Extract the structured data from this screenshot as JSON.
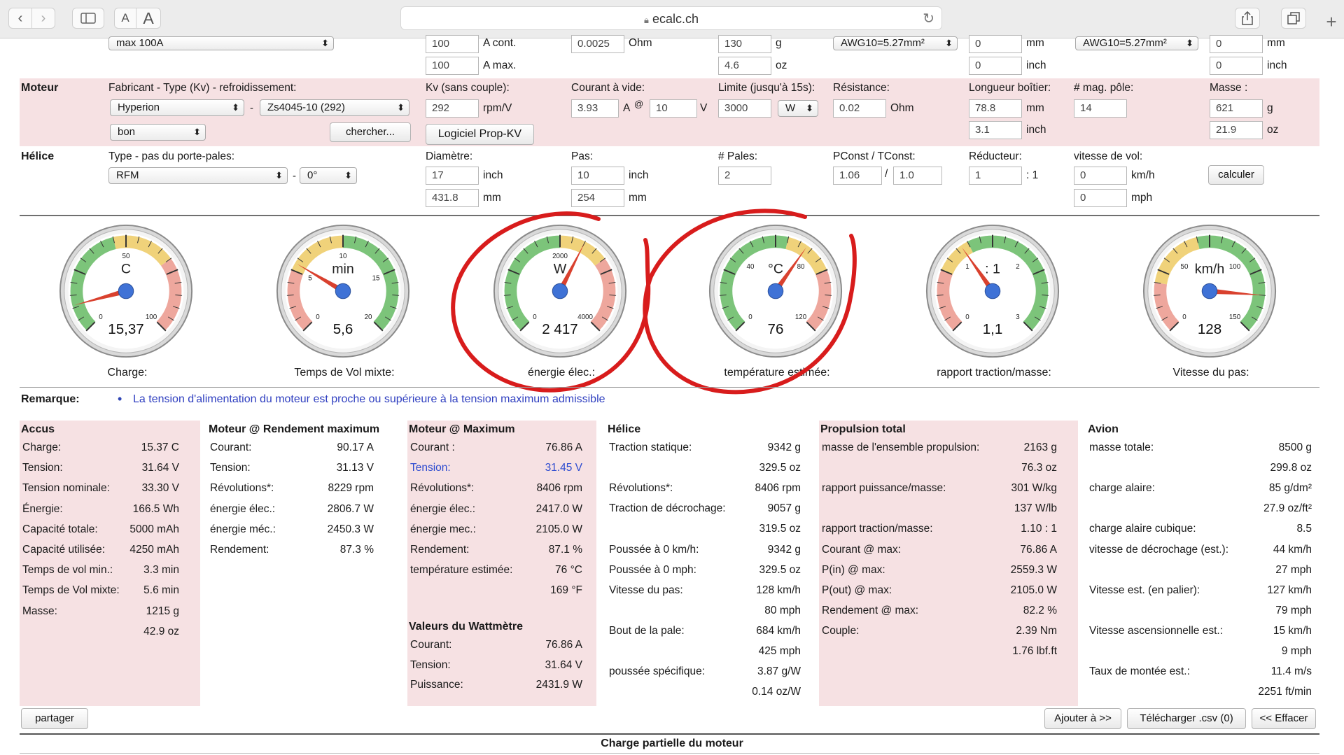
{
  "browser": {
    "url": "ecalc.ch",
    "font_small": "A",
    "font_large": "A"
  },
  "esc_row": {
    "select_value": "max 100A",
    "cont_current": "100",
    "cont_unit": "A cont.",
    "max_current": "100",
    "max_unit": "A max.",
    "resistance": "0.0025",
    "resistance_unit": "Ohm",
    "weight_g": "130",
    "weight_g_unit": "g",
    "weight_oz": "4.6",
    "weight_oz_unit": "oz",
    "wire1": "AWG10=5.27mm²",
    "wire1_mm": "0",
    "wire1_mm_unit": "mm",
    "wire1_inch": "0",
    "wire1_inch_unit": "inch",
    "wire2": "AWG10=5.27mm²",
    "wire2_mm": "0",
    "wire2_mm_unit": "mm",
    "wire2_inch": "0",
    "wire2_inch_unit": "inch"
  },
  "moteur": {
    "title": "Moteur",
    "maker_label": "Fabricant - Type (Kv) - refroidissement:",
    "maker": "Hyperion",
    "dash": "-",
    "type": "Zs4045-10 (292)",
    "cooling": "bon",
    "search_button": "chercher...",
    "kv_label": "Kv (sans couple):",
    "kv": "292",
    "kv_unit": "rpm/V",
    "propkv_button": "Logiciel Prop-KV",
    "idle_label": "Courant à vide:",
    "idle_current": "3.93",
    "idle_unit": "A",
    "at": "@",
    "idle_voltage": "10",
    "idle_v_unit": "V",
    "limit_label": "Limite (jusqu'à 15s):",
    "limit": "3000",
    "limit_unit": "W",
    "res_label": "Résistance:",
    "res": "0.02",
    "res_unit": "Ohm",
    "len_label": "Longueur boîtier:",
    "len_mm": "78.8",
    "len_mm_unit": "mm",
    "len_inch": "3.1",
    "len_inch_unit": "inch",
    "poles_label": "# mag. pôle:",
    "poles": "14",
    "mass_label": "Masse :",
    "mass_g": "621",
    "mass_g_unit": "g",
    "mass_oz": "21.9",
    "mass_oz_unit": "oz"
  },
  "helice": {
    "title": "Hélice",
    "type_label": "Type - pas du porte-pales:",
    "type": "RFM",
    "dash": "-",
    "pitch_angle": "0°",
    "diam_label": "Diamètre:",
    "diam_inch": "17",
    "diam_inch_unit": "inch",
    "diam_mm": "431.8",
    "diam_mm_unit": "mm",
    "pitch_label": "Pas:",
    "pitch_inch": "10",
    "pitch_inch_unit": "inch",
    "pitch_mm": "254",
    "pitch_mm_unit": "mm",
    "blades_label": "# Pales:",
    "blades": "2",
    "pconst_label": "PConst / TConst:",
    "pconst": "1.06",
    "slash": "/",
    "tconst": "1.0",
    "gear_label": "Réducteur:",
    "gear": "1",
    "gear_unit": ": 1",
    "speed_label": "vitesse de vol:",
    "speed_kmh": "0",
    "speed_kmh_unit": "km/h",
    "speed_mph": "0",
    "speed_mph_unit": "mph",
    "calc_button": "calculer"
  },
  "gauges": [
    {
      "unit": "C",
      "ticks": [
        "0",
        "50",
        "100"
      ],
      "value": "15,37",
      "caption": "Charge:",
      "needle_fraction": 0.11
    },
    {
      "unit": "min",
      "ticks": [
        "0",
        "5",
        "10",
        "15",
        "20"
      ],
      "value": "5,6",
      "caption": "Temps de Vol mixte:",
      "needle_fraction": 0.28
    },
    {
      "unit": "W",
      "ticks": [
        "0",
        "2000",
        "4000"
      ],
      "value": "2 417",
      "caption": "énergie élec.:",
      "needle_fraction": 0.6
    },
    {
      "unit": "°C",
      "ticks": [
        "0",
        "40",
        "80",
        "120"
      ],
      "value": "76",
      "caption": "température estimée:",
      "needle_fraction": 0.63
    },
    {
      "unit": ": 1",
      "ticks": [
        "0",
        "1",
        "2",
        "3"
      ],
      "value": "1,1",
      "caption": "rapport traction/masse:",
      "needle_fraction": 0.37
    },
    {
      "unit": "km/h",
      "ticks": [
        "0",
        "50",
        "100",
        "150"
      ],
      "value": "128",
      "caption": "Vitesse du pas:",
      "needle_fraction": 0.85
    }
  ],
  "gauge_colors": {
    "green": "#7cc47a",
    "yellow": "#f0d27a",
    "red": "#eea79d",
    "needle": "#d9412e",
    "hub": "#3f72d6",
    "annotation": "#d81c1c"
  },
  "remark": {
    "label": "Remarque:",
    "bullet": "•",
    "text": "La tension d'alimentation du moteur est proche ou supérieure à la tension maximum admissible"
  },
  "accus": {
    "title": "Accus",
    "rows": [
      {
        "label": "Charge:",
        "value": "15.37 C"
      },
      {
        "label": "Tension:",
        "value": "31.64 V"
      },
      {
        "label": "Tension nominale:",
        "value": "33.30 V"
      },
      {
        "label": "Énergie:",
        "value": "166.5 Wh"
      },
      {
        "label": "Capacité totale:",
        "value": "5000 mAh"
      },
      {
        "label": "Capacité utilisée:",
        "value": "4250 mAh"
      },
      {
        "label": "Temps de vol min.:",
        "value": "3.3 min"
      },
      {
        "label": "Temps de Vol mixte:",
        "value": "5.6 min"
      },
      {
        "label": "Masse:",
        "value": "1215 g"
      },
      {
        "label": "",
        "value": "42.9 oz"
      }
    ]
  },
  "moteur_eff": {
    "title": "Moteur @ Rendement maximum",
    "rows": [
      {
        "label": "Courant:",
        "value": "90.17 A"
      },
      {
        "label": "Tension:",
        "value": "31.13 V"
      },
      {
        "label": "Révolutions*:",
        "value": "8229 rpm"
      },
      {
        "label": "énergie élec.:",
        "value": "2806.7 W"
      },
      {
        "label": "énergie méc.:",
        "value": "2450.3 W"
      },
      {
        "label": "Rendement:",
        "value": "87.3 %"
      }
    ]
  },
  "moteur_max": {
    "title": "Moteur @ Maximum",
    "rows": [
      {
        "label": "Courant :",
        "value": "76.86 A"
      },
      {
        "label": "Tension:",
        "value": "31.45 V"
      },
      {
        "label": "Révolutions*:",
        "value": "8406 rpm"
      },
      {
        "label": "énergie élec.:",
        "value": "2417.0 W"
      },
      {
        "label": "énergie mec.:",
        "value": "2105.0 W"
      },
      {
        "label": "Rendement:",
        "value": "87.1 %"
      },
      {
        "label": "température estimée:",
        "value": "76 °C"
      },
      {
        "label": "",
        "value": "169 °F"
      }
    ],
    "watt_title": "Valeurs du Wattmètre",
    "watt_rows": [
      {
        "label": "Courant:",
        "value": "76.86 A"
      },
      {
        "label": "Tension:",
        "value": "31.64 V"
      },
      {
        "label": "Puissance:",
        "value": "2431.9 W"
      }
    ]
  },
  "helice_res": {
    "title": "Hélice",
    "rows": [
      {
        "label": "Traction statique:",
        "value": "9342 g"
      },
      {
        "label": "",
        "value": "329.5 oz"
      },
      {
        "label": "Révolutions*:",
        "value": "8406 rpm"
      },
      {
        "label": "Traction de décrochage:",
        "value": "9057 g"
      },
      {
        "label": "",
        "value": "319.5 oz"
      },
      {
        "label": "Poussée à 0 km/h:",
        "value": "9342 g"
      },
      {
        "label": "Poussée à 0 mph:",
        "value": "329.5 oz"
      },
      {
        "label": "Vitesse du pas:",
        "value": "128 km/h"
      },
      {
        "label": "",
        "value": "80 mph"
      },
      {
        "label": "Bout de la pale:",
        "value": "684 km/h"
      },
      {
        "label": "",
        "value": "425 mph"
      },
      {
        "label": "poussée spécifique:",
        "value": "3.87 g/W"
      },
      {
        "label": "",
        "value": "0.14 oz/W"
      }
    ]
  },
  "propulsion": {
    "title": "Propulsion total",
    "rows": [
      {
        "label": "masse de l'ensemble propulsion:",
        "value": "2163 g"
      },
      {
        "label": "",
        "value": "76.3 oz"
      },
      {
        "label": "rapport puissance/masse:",
        "value": "301 W/kg"
      },
      {
        "label": "",
        "value": "137 W/lb"
      },
      {
        "label": "rapport traction/masse:",
        "value": "1.10 : 1"
      },
      {
        "label": "Courant @ max:",
        "value": "76.86 A"
      },
      {
        "label": "P(in) @ max:",
        "value": "2559.3 W"
      },
      {
        "label": "P(out) @ max:",
        "value": "2105.0 W"
      },
      {
        "label": "Rendement @ max:",
        "value": "82.2 %"
      },
      {
        "label": "Couple:",
        "value": "2.39 Nm"
      },
      {
        "label": "",
        "value": "1.76 lbf.ft"
      }
    ]
  },
  "avion": {
    "title": "Avion",
    "rows": [
      {
        "label": "masse totale:",
        "value": "8500 g"
      },
      {
        "label": "",
        "value": "299.8 oz"
      },
      {
        "label": "charge alaire:",
        "value": "85 g/dm²"
      },
      {
        "label": "",
        "value": "27.9 oz/ft²"
      },
      {
        "label": "charge alaire cubique:",
        "value": "8.5"
      },
      {
        "label": "vitesse de décrochage (est.):",
        "value": "44 km/h"
      },
      {
        "label": "",
        "value": "27 mph"
      },
      {
        "label": "Vitesse est. (en palier):",
        "value": "127 km/h"
      },
      {
        "label": "",
        "value": "79 mph"
      },
      {
        "label": "Vitesse ascensionnelle est.:",
        "value": "15 km/h"
      },
      {
        "label": "",
        "value": "9 mph"
      },
      {
        "label": "Taux de montée est.:",
        "value": "11.4 m/s"
      },
      {
        "label": "",
        "value": "2251 ft/min"
      }
    ]
  },
  "actions": {
    "share": "partager",
    "add": "Ajouter à >>",
    "download": "Télécharger .csv (0)",
    "clear": "<< Effacer"
  },
  "bottom_title": "Charge partielle du moteur"
}
